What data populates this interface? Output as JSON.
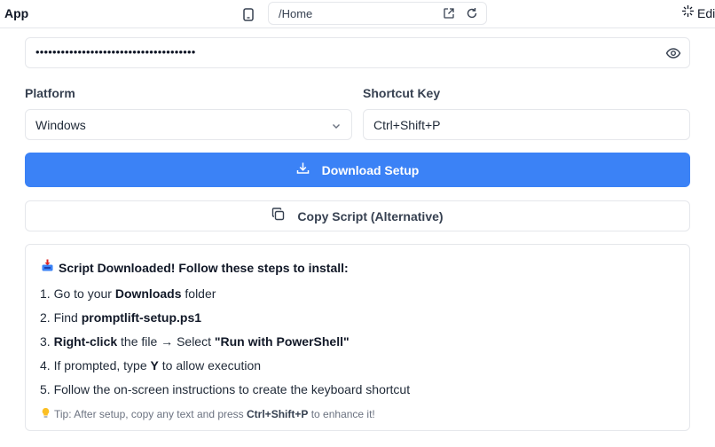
{
  "topbar": {
    "app_title": "App",
    "url": "/Home",
    "edit_label": "Edi"
  },
  "form": {
    "password_value": "••••••••••••••••••••••••••••••••••••••",
    "platform_label": "Platform",
    "platform_value": "Windows",
    "shortcut_label": "Shortcut Key",
    "shortcut_value": "Ctrl+Shift+P",
    "download_label": "Download Setup",
    "copy_label": "Copy Script (Alternative)"
  },
  "steps": {
    "title": "Script Downloaded! Follow these steps to install:",
    "s1_pre": "1. Go to your ",
    "s1_bold": "Downloads",
    "s1_post": " folder",
    "s2_pre": "2. Find ",
    "s2_bold": "promptlift-setup.ps1",
    "s3_pre": "3. ",
    "s3_bold1": "Right-click",
    "s3_mid": " the file → Select ",
    "s3_bold2": "\"Run with PowerShell\"",
    "s4_pre": "4. If prompted, type ",
    "s4_bold": "Y",
    "s4_post": " to allow execution",
    "s5": "5. Follow the on-screen instructions to create the keyboard shortcut",
    "tip_pre": "Tip: After setup, copy any text and press ",
    "tip_bold": "Ctrl+Shift+P",
    "tip_post": " to enhance it!"
  },
  "colors": {
    "primary": "#3b82f6",
    "border": "#e5e7eb"
  },
  "icons": [
    "device-icon",
    "open-external-icon",
    "reload-icon",
    "sparkle-edit-icon",
    "eye-icon",
    "chevron-down-icon",
    "download-icon",
    "copy-icon",
    "inbox-tray-icon",
    "lightbulb-icon"
  ]
}
